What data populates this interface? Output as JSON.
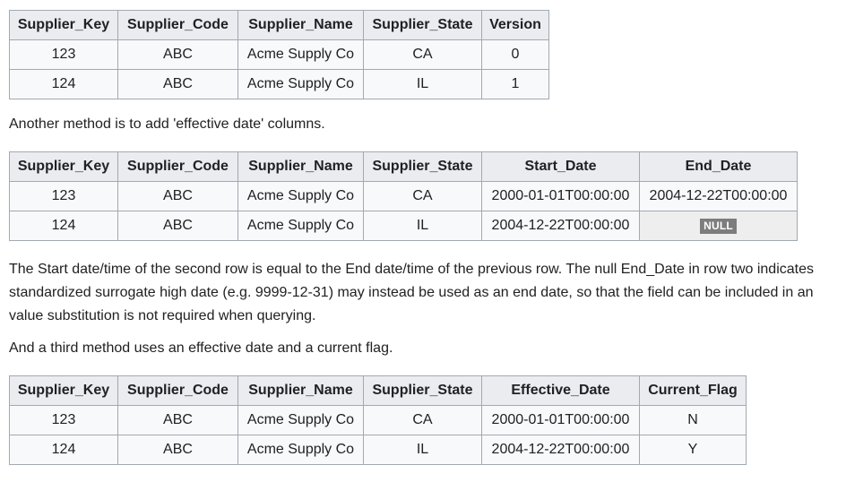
{
  "table1": {
    "headers": [
      "Supplier_Key",
      "Supplier_Code",
      "Supplier_Name",
      "Supplier_State",
      "Version"
    ],
    "rows": [
      [
        "123",
        "ABC",
        "Acme Supply Co",
        "CA",
        "0"
      ],
      [
        "124",
        "ABC",
        "Acme Supply Co",
        "IL",
        "1"
      ]
    ]
  },
  "paragraph1": "Another method is to add 'effective date' columns.",
  "table2": {
    "headers": [
      "Supplier_Key",
      "Supplier_Code",
      "Supplier_Name",
      "Supplier_State",
      "Start_Date",
      "End_Date"
    ],
    "rows": [
      [
        "123",
        "ABC",
        "Acme Supply Co",
        "CA",
        "2000-01-01T00:00:00",
        "2004-12-22T00:00:00"
      ],
      [
        "124",
        "ABC",
        "Acme Supply Co",
        "IL",
        "2004-12-22T00:00:00",
        "NULL"
      ]
    ]
  },
  "paragraph2": {
    "line1": "The Start date/time of the second row is equal to the End date/time of the previous row. The null End_Date in row two indicates",
    "line2": "standardized surrogate high date (e.g. 9999-12-31) may instead be used as an end date, so that the field can be included in an",
    "line3": "value substitution is not required when querying."
  },
  "paragraph3": "And a third method uses an effective date and a current flag.",
  "table3": {
    "headers": [
      "Supplier_Key",
      "Supplier_Code",
      "Supplier_Name",
      "Supplier_State",
      "Effective_Date",
      "Current_Flag"
    ],
    "rows": [
      [
        "123",
        "ABC",
        "Acme Supply Co",
        "CA",
        "2000-01-01T00:00:00",
        "N"
      ],
      [
        "124",
        "ABC",
        "Acme Supply Co",
        "IL",
        "2004-12-22T00:00:00",
        "Y"
      ]
    ]
  }
}
